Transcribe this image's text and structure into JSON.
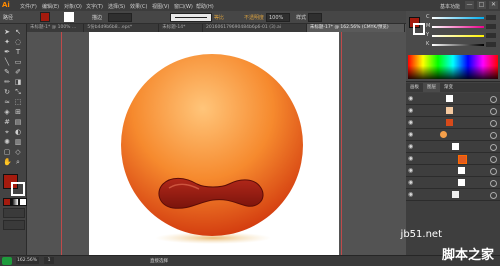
{
  "app": {
    "logo": "Ai",
    "menus": [
      "文件(F)",
      "编辑(E)",
      "对象(O)",
      "文字(T)",
      "选择(S)",
      "效果(C)",
      "视图(V)",
      "窗口(W)",
      "帮助(H)"
    ],
    "workspace": "基本功能",
    "window_buttons": [
      "—",
      "□",
      "✕"
    ]
  },
  "control_bar": {
    "path_label": "路径",
    "stroke_label": "描边",
    "opacity_label": "不透明度",
    "opacity_value": "100%",
    "style_label": "样式",
    "stroke_profile": "基本",
    "stroke_profile_label": "等比"
  },
  "tabs": [
    {
      "label": "未标题-1* @ 100% ...",
      "active": false
    },
    {
      "label": "5份b4d9b6b8...eps*",
      "active": false
    },
    {
      "label": "未标题-14*",
      "active": false
    },
    {
      "label": "201606179690484b6p6-01 (3).ai",
      "active": false
    },
    {
      "label": "未标题-17* @ 162.56% (CMYK/预览)",
      "active": true
    }
  ],
  "colors": {
    "fill": "#a41b0e",
    "accent": "#ff8a00",
    "ball_light": "#ffb25a",
    "ball_dark": "#d33a0e",
    "mouth": "#8a1a10"
  },
  "status": {
    "zoom": "162.56%",
    "tool": "直接选择",
    "page": "1"
  },
  "color_panel": {
    "c_label": "C",
    "m_label": "M",
    "y_label": "Y",
    "k_label": "K"
  },
  "layers_panel": {
    "tabs": [
      "画板",
      "图层",
      "渐变"
    ],
    "rows": 10
  },
  "watermark": {
    "site": "jb51.net",
    "name": "脚本之家"
  }
}
